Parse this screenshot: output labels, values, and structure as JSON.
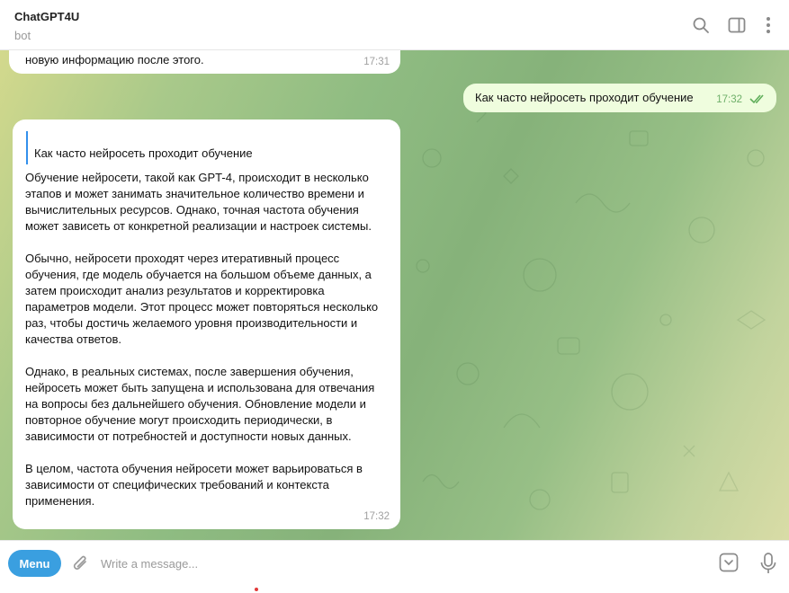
{
  "header": {
    "title": "ChatGPT4U",
    "subtitle": "bot"
  },
  "messages": [
    {
      "direction": "incoming",
      "text": "новую информацию после этого.",
      "time": "17:31"
    },
    {
      "direction": "outgoing",
      "text": "Как часто нейросеть проходит обучение",
      "time": "17:32",
      "status": "double-check-read"
    },
    {
      "direction": "incoming",
      "reply_to": "Как часто нейросеть проходит обучение",
      "paragraphs": [
        "Обучение нейросети, такой как GPT-4, происходит в несколько этапов и может занимать значительное количество времени и вычислительных ресурсов. Однако, точная частота обучения может зависеть от конкретной реализации и настроек системы.",
        "Обычно, нейросети проходят через итеративный процесс обучения, где модель обучается на большом объеме данных, а затем происходит анализ результатов и корректировка параметров модели. Этот процесс может повторяться несколько раз, чтобы достичь желаемого уровня производительности и качества ответов.",
        "Однако, в реальных системах, после завершения обучения, нейросеть может быть запущена и использована для отвечания на вопросы без дальнейшего обучения. Обновление модели и повторное обучение могут происходить периодически, в зависимости от потребностей и доступности новых данных.",
        "В целом, частота обучения нейросети может варьироваться в зависимости от специфических требований и контекста применения."
      ],
      "time": "17:32"
    }
  ],
  "composer": {
    "menu_label": "Menu",
    "placeholder": "Write a message..."
  },
  "colors": {
    "accent": "#3a9fe0",
    "outgoing_bubble": "#effdde",
    "incoming_bubble": "#ffffff"
  },
  "icons": [
    "search-icon",
    "sidebar-toggle-icon",
    "more-vertical-icon",
    "paperclip-icon",
    "bot-commands-icon",
    "microphone-icon",
    "double-check-icon"
  ]
}
